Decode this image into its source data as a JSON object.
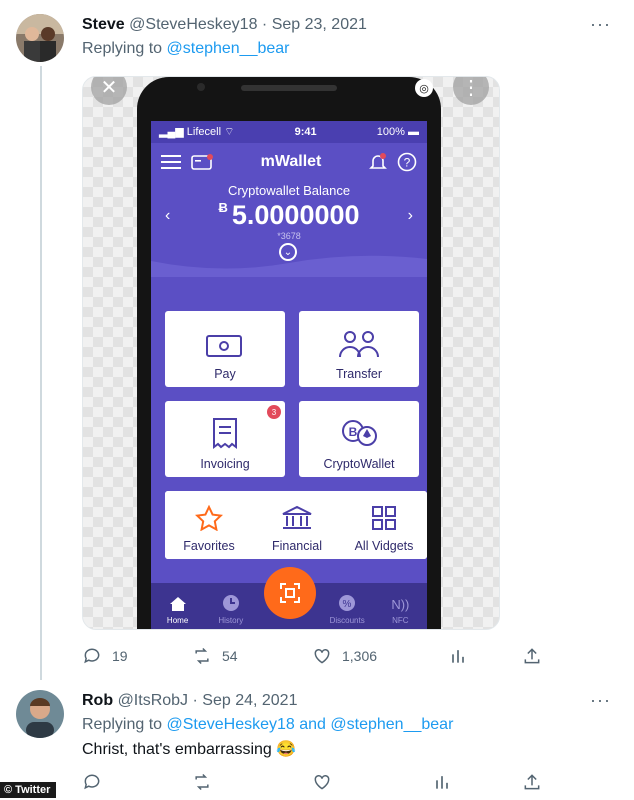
{
  "tweet1": {
    "display_name": "Steve",
    "handle": "@SteveHeskey18",
    "date": "· Sep 23, 2021",
    "replying_label": "Replying to",
    "replying_to": "@stephen__bear",
    "more": "···",
    "actions": {
      "replies": "19",
      "retweets": "54",
      "likes": "1,306"
    }
  },
  "phone": {
    "carrier": "Lifecell",
    "time": "9:41",
    "battery": "100%",
    "app_title": "mWallet",
    "balance_label": "Cryptowallet Balance",
    "currency_symbol": "Ƀ",
    "balance": "5.0000000",
    "account": "*3678",
    "tiles": {
      "pay": "Pay",
      "transfer": "Transfer",
      "invoicing": "Invoicing",
      "invoicing_badge": "3",
      "cryptowallet": "CryptoWallet",
      "favorites": "Favorites",
      "financial": "Financial",
      "all_vidgets": "All Vidgets"
    },
    "tabs": {
      "home": "Home",
      "history": "History",
      "discounts": "Discounts",
      "nfc": "NFC"
    }
  },
  "tweet2": {
    "display_name": "Rob",
    "handle": "@ItsRobJ",
    "date": "· Sep 24, 2021",
    "replying_label": "Replying to",
    "replying_to": "@SteveHeskey18 and @stephen__bear",
    "text": "Christ, that's embarrassing 😂",
    "more": "···"
  },
  "watermark": "© Twitter",
  "colors": {
    "link": "#1d9bf0",
    "app_purple": "#5b4fc4",
    "fab_orange": "#ff6a1a"
  }
}
